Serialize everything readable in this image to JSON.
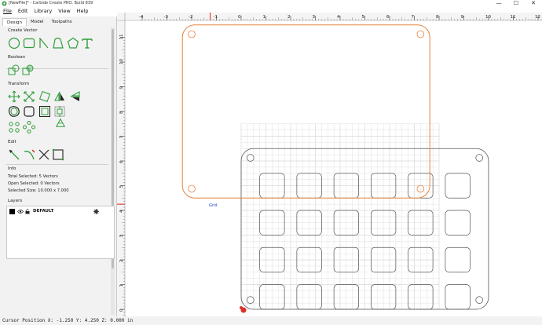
{
  "window": {
    "title": "[NewFile]* - Carbide Create PRO, Build 839",
    "minimize": "—",
    "maximize": "☐",
    "close": "✕"
  },
  "menu": [
    "File",
    "Edit",
    "Library",
    "View",
    "Help"
  ],
  "tabs": [
    "Design",
    "Model",
    "Toolpaths"
  ],
  "sections": {
    "create_vector": "Create Vector",
    "boolean": "Boolean",
    "transform": "Transform",
    "edit": "Edit",
    "info": "Info",
    "layers": "Layers"
  },
  "icons": {
    "create_vector": [
      "circle-icon",
      "rectangle-icon",
      "polyline-icon",
      "curve-icon",
      "polygon-icon",
      "text-icon"
    ],
    "boolean": [
      "union-icon",
      "subtract-icon"
    ],
    "transform_row1": [
      "move-icon",
      "scale-icon",
      "rotate-icon",
      "mirror-horizontal-icon",
      "mirror-vertical-icon"
    ],
    "transform_row2": [
      "offset-icon",
      "fillet-icon",
      "inset-icon",
      "align-icon",
      "triangle-icon"
    ],
    "transform_row3": [
      "array-icon",
      "circular-array-icon",
      "pattern-icon"
    ],
    "edit": [
      "node-edit-icon",
      "curve-edit-icon",
      "trim-icon",
      "join-icon"
    ]
  },
  "info": {
    "total_selected": "Total Selected:    5 Vectors",
    "open_selected": "Open Selected:    0 Vectors",
    "selected_size": "Selected Size:    10.000 x 7.000"
  },
  "layers": [
    {
      "name": "DEFAULT",
      "color": "#000000"
    }
  ],
  "ruler": {
    "x_labels": [
      "-4",
      "-3",
      "-2",
      "-1",
      "0",
      "1",
      "2",
      "3",
      "4",
      "5",
      "6",
      "7",
      "8",
      "9",
      "10",
      "11",
      "12",
      "13"
    ],
    "y_labels": [
      "11",
      "10",
      "9",
      "8",
      "7",
      "6",
      "5",
      "4",
      "3",
      "2",
      "1",
      "0"
    ]
  },
  "grid_label": "Grid",
  "status": "Cursor Position X: -1.250 Y: 4.250 Z: 0.000 in",
  "colors": {
    "selection": "#e8823a",
    "geometry": "#555555",
    "grid": "#d8d8d8",
    "accent_green": "#2e9d3a",
    "ruler_marker": "#e02020"
  }
}
